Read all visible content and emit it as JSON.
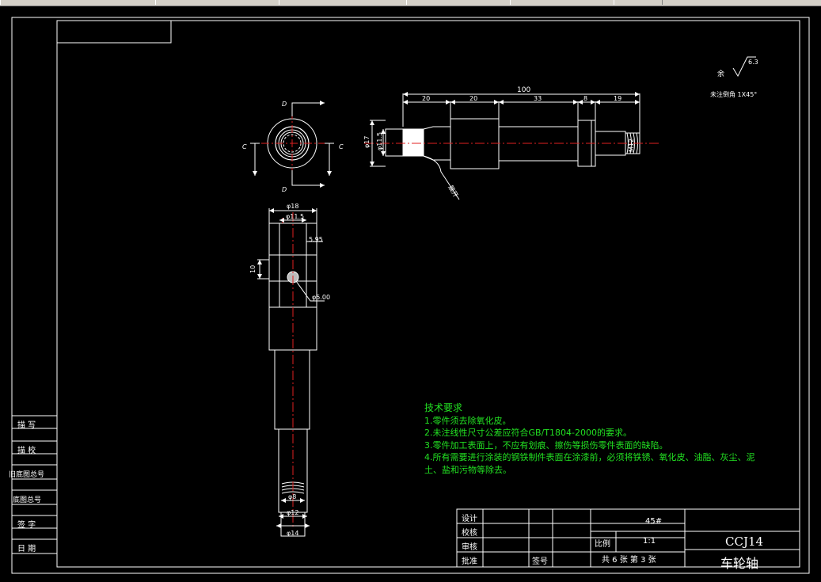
{
  "window": {
    "toolbar_segments": 6
  },
  "colors": {
    "background": "#000000",
    "frame": "#ffffff",
    "centerline": "#e02020",
    "notes": "#22e022",
    "hatch": "#c8c8c8"
  },
  "drawing": {
    "roughness_label": "余",
    "roughness_value": "6.3",
    "chamfer_note": "未注倒角 1X45°",
    "dims_top": {
      "overall": "100",
      "seg1": "20",
      "seg2": "20",
      "seg3": "33",
      "seg4": "8",
      "seg5": "19",
      "dia_left_outer": "φ17",
      "dia_left_inner": "φ11.5",
      "thread": "M12",
      "leader": "展开"
    },
    "section_labels": {
      "d_top": "D",
      "d_bottom": "D",
      "c_left": "C",
      "c_right": "C"
    },
    "dims_vertical": {
      "top_dia": "φ18",
      "inner_dia": "φ11.5",
      "side": "5.95",
      "height": "10",
      "hole": "φ5.00",
      "lower_dia": "φ12",
      "bottom_dia": "φ14",
      "thread_inner": "φ8"
    }
  },
  "notes": {
    "title": "技术要求",
    "items": [
      "1.零件须去除氧化皮。",
      "2.未注线性尺寸公差应符合GB/T1804-2000的要求。",
      "3.零件加工表面上，不应有划痕、擦伤等损伤零件表面的缺陷。",
      "4.所有需要进行涂装的钢铁制件表面在涂漆前，必须将铁锈、氧化皮、油脂、灰尘、泥",
      "  土、盐和污物等除去。"
    ]
  },
  "left_strip": {
    "items": [
      "描  写",
      "描  校",
      "旧底图总号",
      "底图总号",
      "签  字",
      "日  期"
    ]
  },
  "title_block": {
    "rows": [
      "设计",
      "校核",
      "审核",
      "批准"
    ],
    "sign_label": "签号",
    "material": "45#",
    "scale_label": "比例",
    "scale_value": "1:1",
    "sheets": "共 6 张  第 3 张",
    "drawing_no": "CCJ14",
    "part_name": "车轮轴"
  }
}
